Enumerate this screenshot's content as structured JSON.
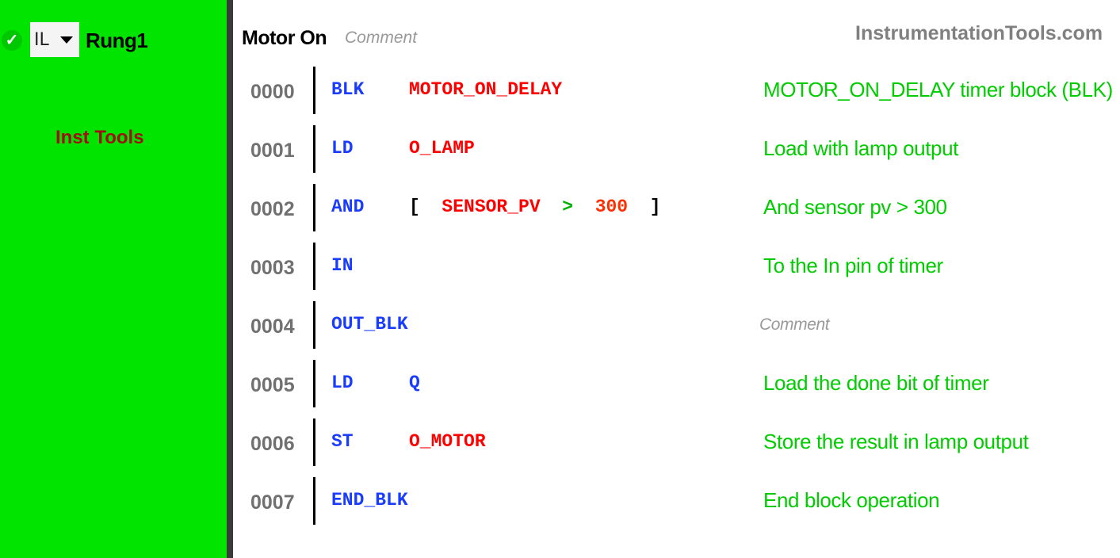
{
  "sidebar": {
    "status_icon": "check-circle-icon",
    "language_select": {
      "value": "IL",
      "icon": "caret-down-icon"
    },
    "rung_name": "Rung1",
    "label": "Inst Tools"
  },
  "header": {
    "rung_title": "Motor On",
    "rung_comment": "Comment",
    "watermark": "InstrumentationTools.com"
  },
  "colors": {
    "sidebar_bg": "#00e400",
    "opcode": "#1a3cff",
    "operand": "#ff0000",
    "comment": "#00cc00",
    "line_number": "#707070"
  },
  "rows": [
    {
      "line": "0000",
      "op": "BLK",
      "operand": "MOTOR_ON_DELAY",
      "comment": "MOTOR_ON_DELAY timer block (BLK)"
    },
    {
      "line": "0001",
      "op": "LD",
      "operand": "O_LAMP",
      "comment": "Load with lamp output"
    },
    {
      "line": "0002",
      "op": "AND",
      "operand_expr": {
        "open": "[",
        "var": "SENSOR_PV",
        "cmp": ">",
        "value": "300",
        "close": "]"
      },
      "comment": "And sensor pv > 300"
    },
    {
      "line": "0003",
      "op": "IN",
      "operand": "",
      "comment": "To the In pin of timer"
    },
    {
      "line": "0004",
      "op": "OUT_BLK",
      "operand": "",
      "comment_placeholder": "Comment"
    },
    {
      "line": "0005",
      "op": "LD",
      "operand": "Q",
      "comment": "Load the done bit of timer"
    },
    {
      "line": "0006",
      "op": "ST",
      "operand": "O_MOTOR",
      "comment": "Store the result in lamp output"
    },
    {
      "line": "0007",
      "op": "END_BLK",
      "operand": "",
      "comment": "End block operation"
    }
  ]
}
